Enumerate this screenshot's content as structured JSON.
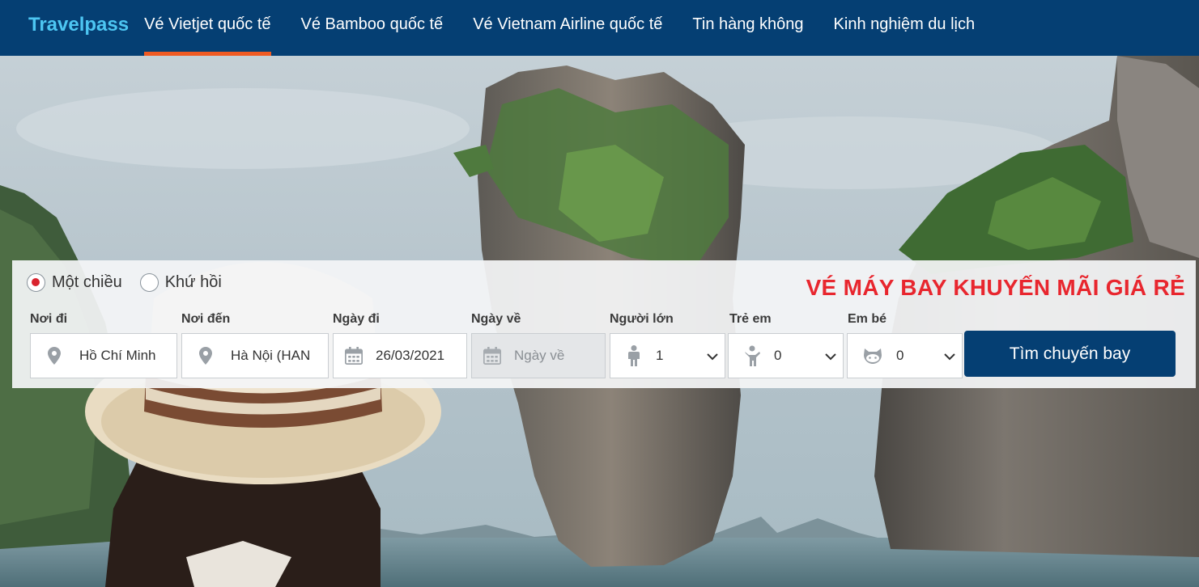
{
  "brand": {
    "logo": "Travelpass"
  },
  "nav": {
    "items": [
      {
        "label": "Vé Vietjet quốc tế",
        "active": true
      },
      {
        "label": "Vé Bamboo quốc tế",
        "active": false
      },
      {
        "label": "Vé Vietnam Airline quốc tế",
        "active": false
      },
      {
        "label": "Tin hàng không",
        "active": false
      },
      {
        "label": "Kinh nghiệm du lịch",
        "active": false
      }
    ]
  },
  "search": {
    "trip_types": [
      {
        "label": "Một chiều",
        "checked": true
      },
      {
        "label": "Khứ hồi",
        "checked": false
      }
    ],
    "promo_title": "VÉ MÁY BAY KHUYẾN MÃI GIÁ RẺ",
    "fields": {
      "origin": {
        "label": "Nơi đi",
        "value": "Hồ Chí Minh",
        "icon": "map-pin-icon"
      },
      "destination": {
        "label": "Nơi đến",
        "value": "Hà Nội (HAN",
        "icon": "map-pin-icon"
      },
      "depart_date": {
        "label": "Ngày đi",
        "value": "26/03/2021",
        "icon": "calendar-icon"
      },
      "return_date": {
        "label": "Ngày về",
        "placeholder": "Ngày về",
        "icon": "calendar-icon",
        "disabled": true
      },
      "adults": {
        "label": "Người lớn",
        "value": "1",
        "icon": "adult-icon"
      },
      "children": {
        "label": "Trẻ em",
        "value": "0",
        "icon": "child-icon"
      },
      "infants": {
        "label": "Em bé",
        "value": "0",
        "icon": "baby-icon"
      }
    },
    "submit_label": "Tìm chuyến bay"
  },
  "colors": {
    "navbar_bg": "#053f73",
    "logo": "#4dc6f2",
    "active_underline": "#f05a22",
    "promo_red": "#e8262e",
    "button_bg": "#053f73",
    "radio_dot": "#d9232e"
  }
}
